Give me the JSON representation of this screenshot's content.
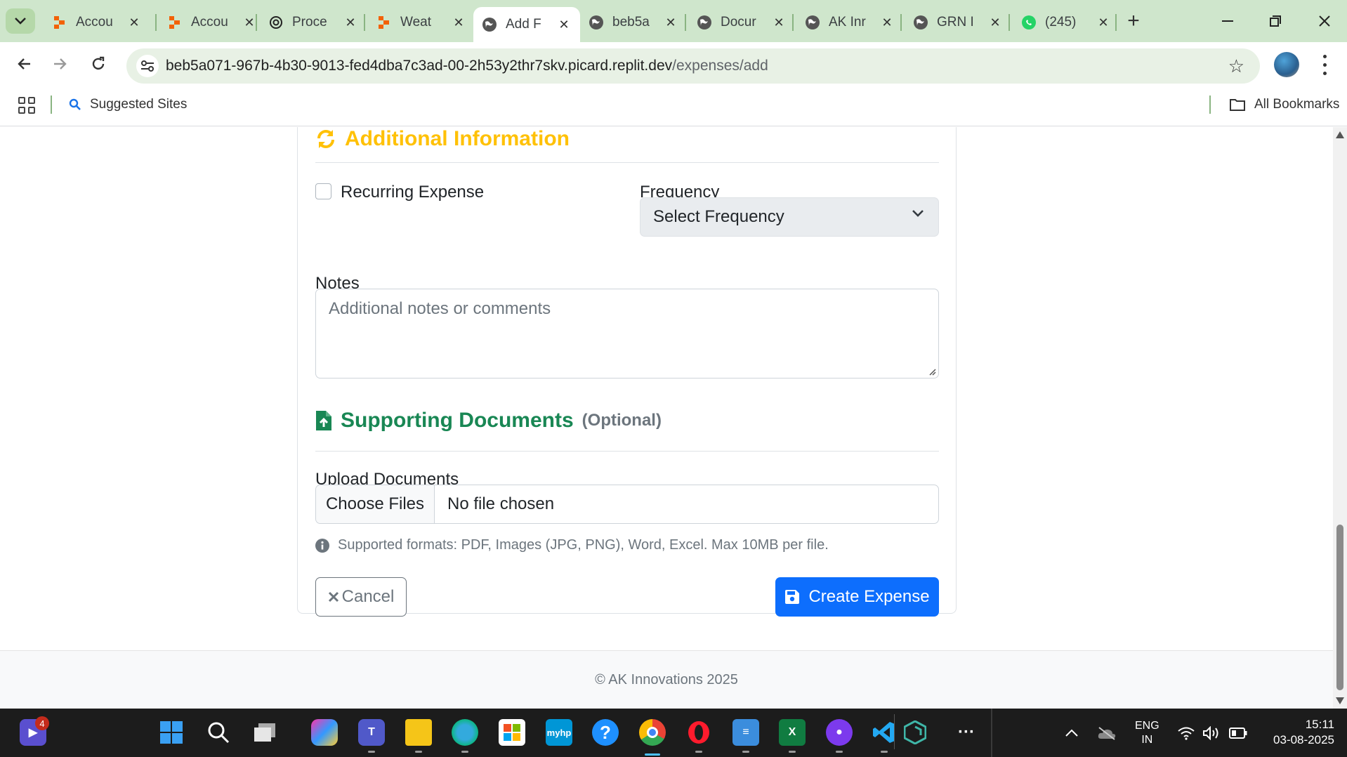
{
  "browser": {
    "tabs": [
      {
        "title": "Accou",
        "favicon": "replit-icon",
        "active": false
      },
      {
        "title": "Accou",
        "favicon": "replit-icon",
        "active": false
      },
      {
        "title": "Proce",
        "favicon": "openai-icon",
        "active": false
      },
      {
        "title": "Weat",
        "favicon": "replit-icon",
        "active": false
      },
      {
        "title": "Add F",
        "favicon": "globe-icon",
        "active": true
      },
      {
        "title": "beb5a",
        "favicon": "globe-icon",
        "active": false
      },
      {
        "title": "Docur",
        "favicon": "globe-icon",
        "active": false
      },
      {
        "title": "AK Inr",
        "favicon": "globe-icon",
        "active": false
      },
      {
        "title": "GRN I",
        "favicon": "globe-icon",
        "active": false
      },
      {
        "title": "(245)",
        "favicon": "whatsapp-icon",
        "active": false
      }
    ],
    "url_host": "beb5a071-967b-4b30-9013-fed4dba7c3ad-00-2h53y2thr7skv.picard.replit.dev",
    "url_path": "/expenses/add",
    "bookmarks": {
      "suggested": "Suggested Sites",
      "all": "All Bookmarks"
    }
  },
  "form": {
    "additional_title": "Additional Information",
    "recurring_label": "Recurring Expense",
    "recurring_checked": false,
    "frequency_label": "Frequency",
    "frequency_value": "Select Frequency",
    "notes_label": "Notes",
    "notes_placeholder": "Additional notes or comments",
    "docs_title": "Supporting Documents",
    "docs_optional": "(Optional)",
    "upload_label": "Upload Documents",
    "choose_files": "Choose Files",
    "no_file": "No file chosen",
    "formats_hint": "Supported formats: PDF, Images (JPG, PNG), Word, Excel. Max 10MB per file.",
    "cancel_label": "Cancel",
    "create_label": "Create Expense"
  },
  "footer": {
    "text": "© AK Innovations 2025"
  },
  "colors": {
    "warning": "#ffc107",
    "success": "#198754",
    "primary": "#0d6efd"
  },
  "taskbar": {
    "badge_count": "4",
    "language": "ENG",
    "region": "IN",
    "time": "15:11",
    "date": "03-08-2025"
  }
}
